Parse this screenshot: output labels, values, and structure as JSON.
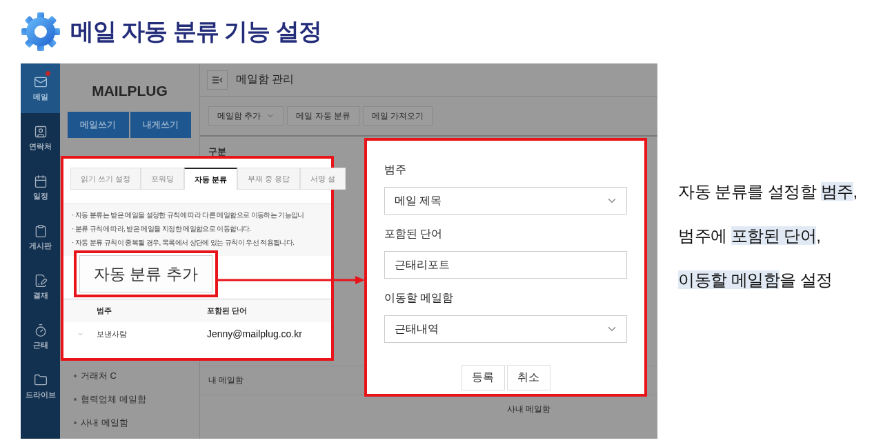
{
  "title": "메일 자동 분류 기능 설정",
  "app": {
    "nav": [
      {
        "kind": "mail",
        "label": "메일",
        "selected": true,
        "notice": true
      },
      {
        "kind": "contacts",
        "label": "연락처",
        "selected": false,
        "notice": false
      },
      {
        "kind": "calendar",
        "label": "일정",
        "selected": false,
        "notice": false
      },
      {
        "kind": "board",
        "label": "게시판",
        "selected": false,
        "notice": false
      },
      {
        "kind": "approval",
        "label": "결재",
        "selected": false,
        "notice": false
      },
      {
        "kind": "timer",
        "label": "근태",
        "selected": false,
        "notice": false
      },
      {
        "kind": "folder",
        "label": "드라이브",
        "selected": false,
        "notice": false
      }
    ],
    "logo": "MAILPLUG",
    "compose_buttons": [
      "메일쓰기",
      "내게쓰기"
    ],
    "folders": [
      "거래처 C",
      "협력업체 메일함",
      "사내 메일함"
    ],
    "page_title": "메일함 관리",
    "toolbar": [
      {
        "label": "메일함 추가",
        "dropdown": true
      },
      {
        "label": "메일 자동 분류",
        "dropdown": false
      },
      {
        "label": "메일 가져오기",
        "dropdown": false
      }
    ],
    "column_header": "구분",
    "cells": [
      "내 메일함",
      "사내 메일함"
    ]
  },
  "settings_inset": {
    "tabs": [
      {
        "label": "읽기 쓰기 설정",
        "selected": false
      },
      {
        "label": "포워딩",
        "selected": false
      },
      {
        "label": "자동 분류",
        "selected": true
      },
      {
        "label": "부재 중 응답",
        "selected": false
      },
      {
        "label": "서명 설",
        "selected": false
      }
    ],
    "notes": [
      "· 자동 분류는 받은 메일을 설정한 규칙에 따라 다른 메일함으로 이동하는 기능입니",
      "· 분류 규칙에 따라, 받은 메일을 지정한 메일함으로 이동합니다.",
      "· 자동 분류 규칙이 중복될 경우, 목록에서 상단에 있는 규칙이 우선 적용됩니다."
    ],
    "add_button": "자동 분류 추가",
    "columns": [
      "범주",
      "포함된 단어"
    ],
    "rows": [
      {
        "category": "보낸사람",
        "word": "Jenny@mailplug.co.kr"
      }
    ]
  },
  "rule_form": {
    "fields": [
      {
        "kind": "select",
        "label": "범주",
        "value": "메일 제목"
      },
      {
        "kind": "input",
        "label": "포함된 단어",
        "value": "근태리포트"
      },
      {
        "kind": "select",
        "label": "이동할 메일함",
        "value": "근태내역"
      }
    ],
    "buttons": [
      "등록",
      "취소"
    ]
  },
  "caption": [
    [
      {
        "text": "자동 분류를 설정할 ",
        "highlight": false
      },
      {
        "text": "범주",
        "highlight": true
      },
      {
        "text": ",",
        "highlight": false
      }
    ],
    [
      {
        "text": "범주에 ",
        "highlight": false
      },
      {
        "text": "포함된 단어",
        "highlight": true
      },
      {
        "text": ",",
        "highlight": false
      }
    ],
    [
      {
        "text": "이동할 메일함",
        "highlight": true
      },
      {
        "text": "을 설정",
        "highlight": false
      }
    ]
  ]
}
